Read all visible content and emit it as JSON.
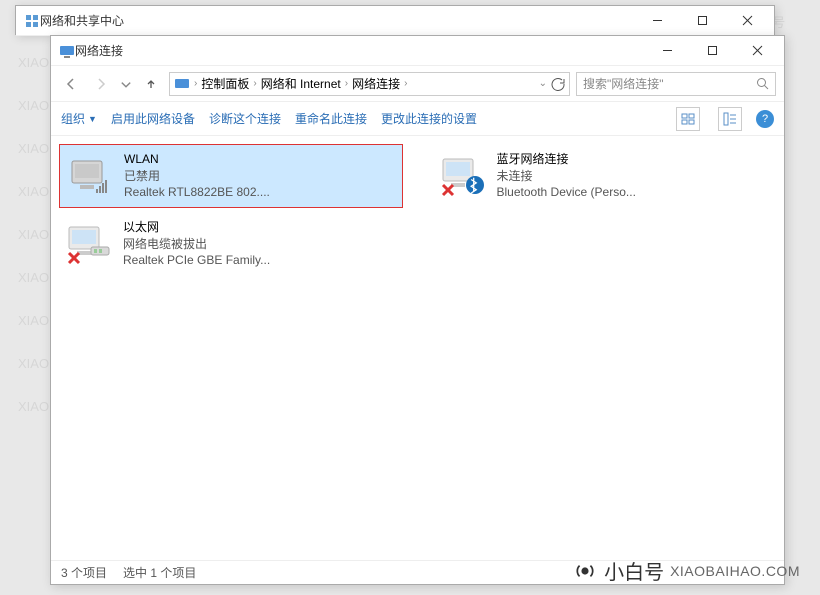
{
  "watermark": {
    "text1": "@小白号",
    "text2": "XIAOBAIHAO.COM"
  },
  "bottom_logo": {
    "name": "小白号",
    "url": "XIAOBAIHAO.COM"
  },
  "back_window": {
    "title": "网络和共享中心"
  },
  "front_window": {
    "title": "网络连接",
    "breadcrumb": [
      "控制面板",
      "网络和 Internet",
      "网络连接"
    ],
    "search_placeholder": "搜索\"网络连接\"",
    "toolbar": {
      "organize": "组织",
      "enable": "启用此网络设备",
      "diagnose": "诊断这个连接",
      "rename": "重命名此连接",
      "change": "更改此连接的设置"
    },
    "items": [
      {
        "name": "WLAN",
        "status": "已禁用",
        "device": "Realtek RTL8822BE 802...."
      },
      {
        "name": "蓝牙网络连接",
        "status": "未连接",
        "device": "Bluetooth Device (Perso..."
      },
      {
        "name": "以太网",
        "status": "网络电缆被拔出",
        "device": "Realtek PCIe GBE Family..."
      }
    ],
    "statusbar": {
      "count": "3 个项目",
      "selected": "选中 1 个项目"
    }
  }
}
